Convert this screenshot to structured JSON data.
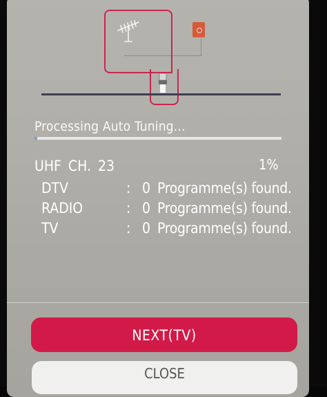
{
  "screen": {
    "title": "Processing Auto Tuning...",
    "progress_fraction": 0.01,
    "channel": "UHF  CH. 23",
    "percent": "1%"
  },
  "results": [
    {
      "name": "DTV",
      "colon": ":",
      "count": "0",
      "text": "Programme(s) found."
    },
    {
      "name": "RADIO",
      "colon": ":",
      "count": "0",
      "text": "Programme(s) found."
    },
    {
      "name": "TV",
      "colon": ":",
      "count": "0",
      "text": "Programme(s) found."
    }
  ],
  "buttons": {
    "next_label": "NEXT(TV)",
    "close_label": "CLOSE"
  },
  "icons": {
    "antenna": "antenna-icon",
    "input": "input-port-icon",
    "plug": "cable-plug-icon"
  },
  "colors": {
    "accent": "#d21a48",
    "highlight": "#c8264f",
    "progress": "#7ea0cf"
  }
}
